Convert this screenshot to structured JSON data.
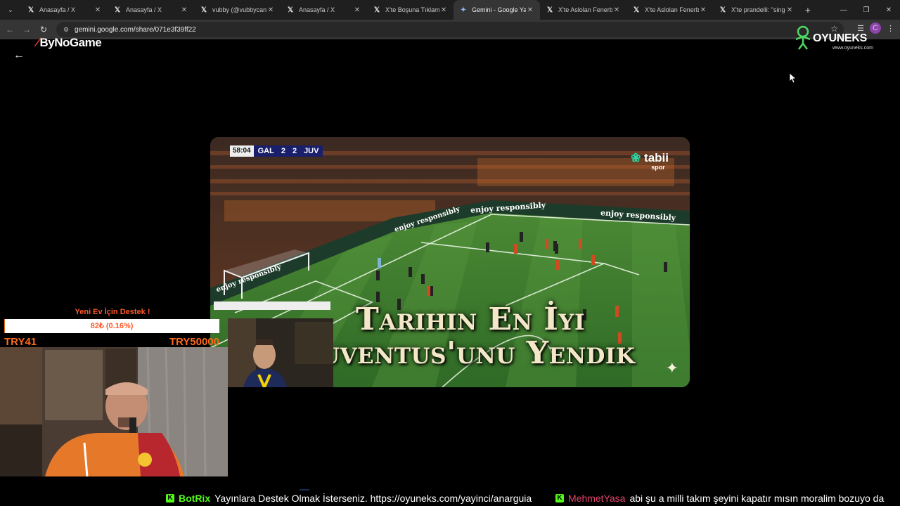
{
  "browser": {
    "tabs": [
      {
        "label": "Anasayfa / X",
        "icon": "x-logo-icon",
        "active": false
      },
      {
        "label": "Anasayfa / X",
        "icon": "x-logo-icon",
        "active": false
      },
      {
        "label": "vubby (@vubbycanG",
        "icon": "x-logo-icon",
        "active": false
      },
      {
        "label": "Anasayfa / X",
        "icon": "x-logo-icon",
        "active": false
      },
      {
        "label": "X'te Boşuna Tıklama",
        "icon": "x-logo-icon",
        "active": false
      },
      {
        "label": "Gemini - Google Yap",
        "icon": "gemini-icon",
        "active": true
      },
      {
        "label": "X'te Aslolan Fenerbal",
        "icon": "x-logo-icon",
        "active": false
      },
      {
        "label": "X'te Aslolan Fenerbal",
        "icon": "x-logo-icon",
        "active": false
      },
      {
        "label": "X'te prandelli: \"singo",
        "icon": "x-logo-icon",
        "active": false
      }
    ],
    "url": "gemini.google.com/share/071e3f39ff22",
    "profile_initial": "C"
  },
  "overlays": {
    "bynogame_logo": "ByNoGame",
    "oyuneks_logo": "OYUNEKS",
    "oyuneks_sub": "www.oyuneks.com"
  },
  "media": {
    "scorebug": {
      "time": "58:04",
      "home": "GAL",
      "home_score": "2",
      "away_score": "2",
      "away": "JUV"
    },
    "broadcaster": "tabii",
    "broadcaster_sub": "spor",
    "headline_line1": "Tarihin En İyi",
    "headline_line2": "Juventus'unu Yendik",
    "ad_boards": [
      "enjoy responsibly",
      "enjoy responsibly",
      "enjoy responsibly",
      "enjoy responsibly"
    ]
  },
  "donation": {
    "title": "Yeni Ev İçin Destek !",
    "amount_text": "82₺ (0.16%)",
    "progress_fraction": 0.0016,
    "min_label": "TRY41",
    "max_label": "TRY50000"
  },
  "ticker": {
    "bot_name": "BotRix",
    "bot_message": "Yayınlara Destek Olmak İsterseniz. https://oyuneks.com/yayinci/anarguia",
    "user_name": "MehmetYasa",
    "user_message": "abi şu a milli takım şeyini kapatır mısın moralim bozuyo da"
  },
  "colors": {
    "accent_orange": "#ff5a2a",
    "kick_green": "#53fc18",
    "scorebug_blue": "#1a1f6b",
    "pitch_green": "#3f7a2e"
  }
}
